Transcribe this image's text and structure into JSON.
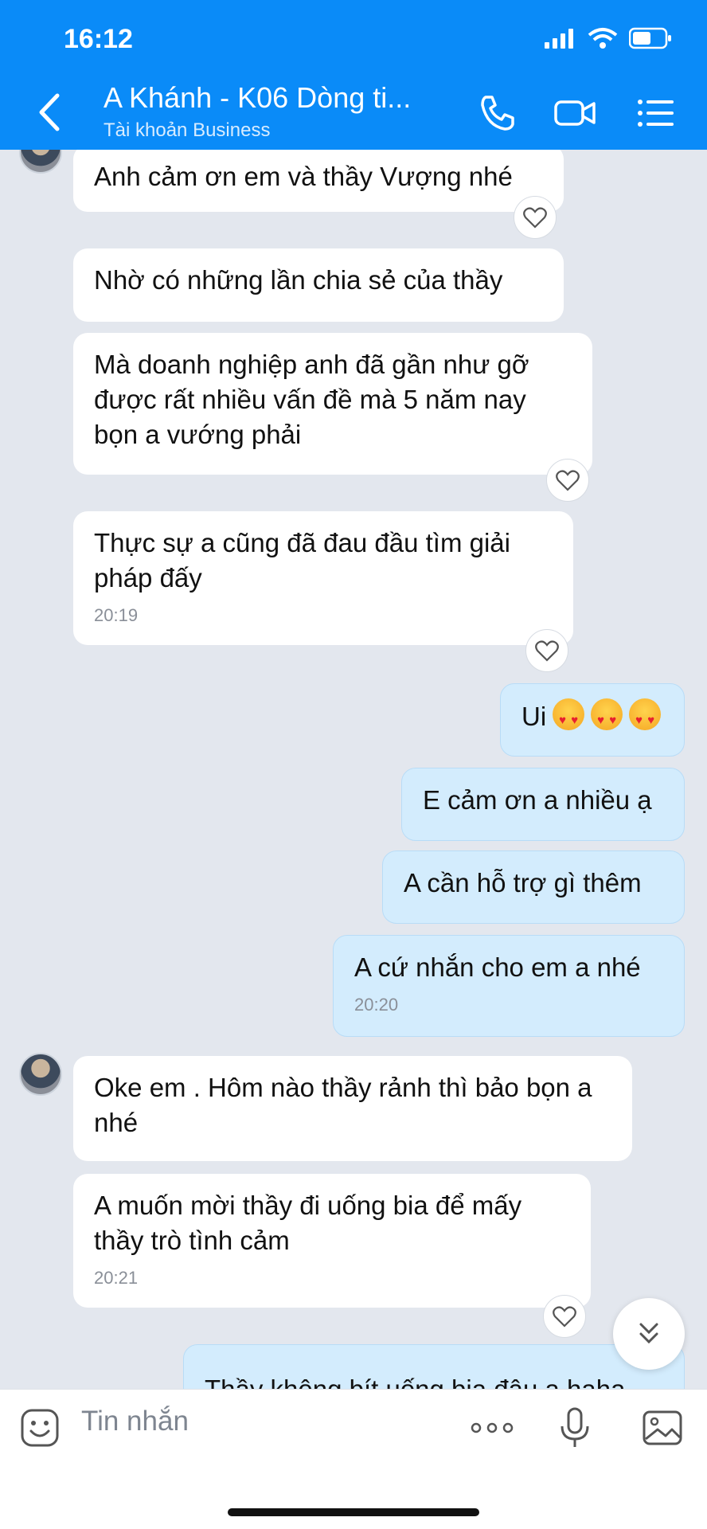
{
  "status_bar": {
    "time": "16:12"
  },
  "header": {
    "title": "A Khánh - K06 Dòng ti...",
    "subtitle": "Tài khoản Business"
  },
  "messages": [
    {
      "text": "Anh cảm ơn em và thầy Vượng nhé"
    },
    {
      "text": "Nhờ có những lần chia sẻ của thầy"
    },
    {
      "text": "Mà doanh nghiệp anh đã gần như gỡ được rất nhiều vấn đề mà 5 năm nay bọn a vướng phải"
    },
    {
      "text": "Thực sự a cũng đã đau đầu tìm giải pháp đấy",
      "time": "20:19"
    },
    {
      "text": "Ui"
    },
    {
      "text": "E cảm ơn a nhiều ạ"
    },
    {
      "text": "A cần hỗ trợ gì thêm"
    },
    {
      "text": "A cứ nhắn cho em a nhé",
      "time": "20:20"
    },
    {
      "text": "Oke em . Hôm nào thầy rảnh thì bảo bọn a nhé"
    },
    {
      "text": "A muốn mời thầy đi uống bia để mấy thầy trò tình cảm",
      "time": "20:21"
    },
    {
      "text": "Thầy không bít uống bia đâu a haha"
    }
  ],
  "input": {
    "placeholder": "Tin nhắn"
  },
  "colors": {
    "header": "#0a8bf8",
    "outgoing": "#d3ecfd",
    "incoming": "#ffffff",
    "background": "#e3e7ee"
  },
  "icons": [
    "back-icon",
    "phone-icon",
    "video-icon",
    "menu-icon",
    "heart-icon",
    "sticker-icon",
    "more-icon",
    "mic-icon",
    "image-icon",
    "chevron-down-icon"
  ]
}
